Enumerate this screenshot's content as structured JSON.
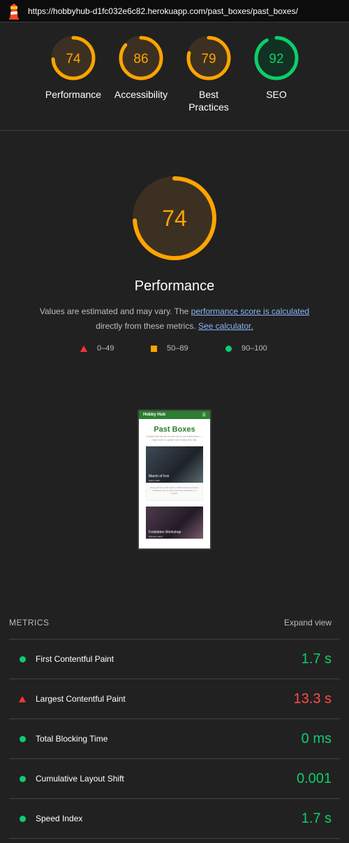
{
  "browser": {
    "url": "https://hobbyhub-d1fc032e6c82.herokuapp.com/past_boxes/past_boxes/"
  },
  "colors": {
    "average": "#ffa400",
    "pass": "#0cce6b",
    "fail": "#ff4e42"
  },
  "categories": [
    {
      "label": "Performance",
      "score": "74",
      "rating": "average"
    },
    {
      "label": "Accessibility",
      "score": "86",
      "rating": "average"
    },
    {
      "label": "Best Practices",
      "score": "79",
      "rating": "average"
    },
    {
      "label": "SEO",
      "score": "92",
      "rating": "pass"
    }
  ],
  "main": {
    "score": "74",
    "title": "Performance",
    "desc_prefix": "Values are estimated and may vary. The ",
    "desc_link1": "performance score is calculated",
    "desc_middle": " directly from these metrics. ",
    "desc_link2": "See calculator."
  },
  "legend": [
    {
      "icon": "triangle-icon",
      "label": "0–49"
    },
    {
      "icon": "square-icon",
      "label": "50–89"
    },
    {
      "icon": "circle-icon",
      "label": "90–100"
    }
  ],
  "thumbnail": {
    "brand": "Hobby Hub",
    "title": "Past Boxes",
    "subtitle": "Explore the kits we've sent out to our subscribers — make sure to update with Hobby Hub kits.",
    "card1_caption": "March of Iron",
    "card1_date": "March 2025",
    "card_text": "Heavy armour, bold colours, battle-hardened veteran miniatures. Every piece was hand-picked by our experts.",
    "card2_caption": "Forbidden Workshop",
    "card2_date": "February 2025"
  },
  "metrics": {
    "header": "METRICS",
    "expand_label": "Expand view",
    "items": [
      {
        "name": "First Contentful Paint",
        "value": "1.7 s",
        "rating": "pass"
      },
      {
        "name": "Largest Contentful Paint",
        "value": "13.3 s",
        "rating": "fail"
      },
      {
        "name": "Total Blocking Time",
        "value": "0 ms",
        "rating": "pass"
      },
      {
        "name": "Cumulative Layout Shift",
        "value": "0.001",
        "rating": "pass"
      },
      {
        "name": "Speed Index",
        "value": "1.7 s",
        "rating": "pass"
      }
    ]
  }
}
